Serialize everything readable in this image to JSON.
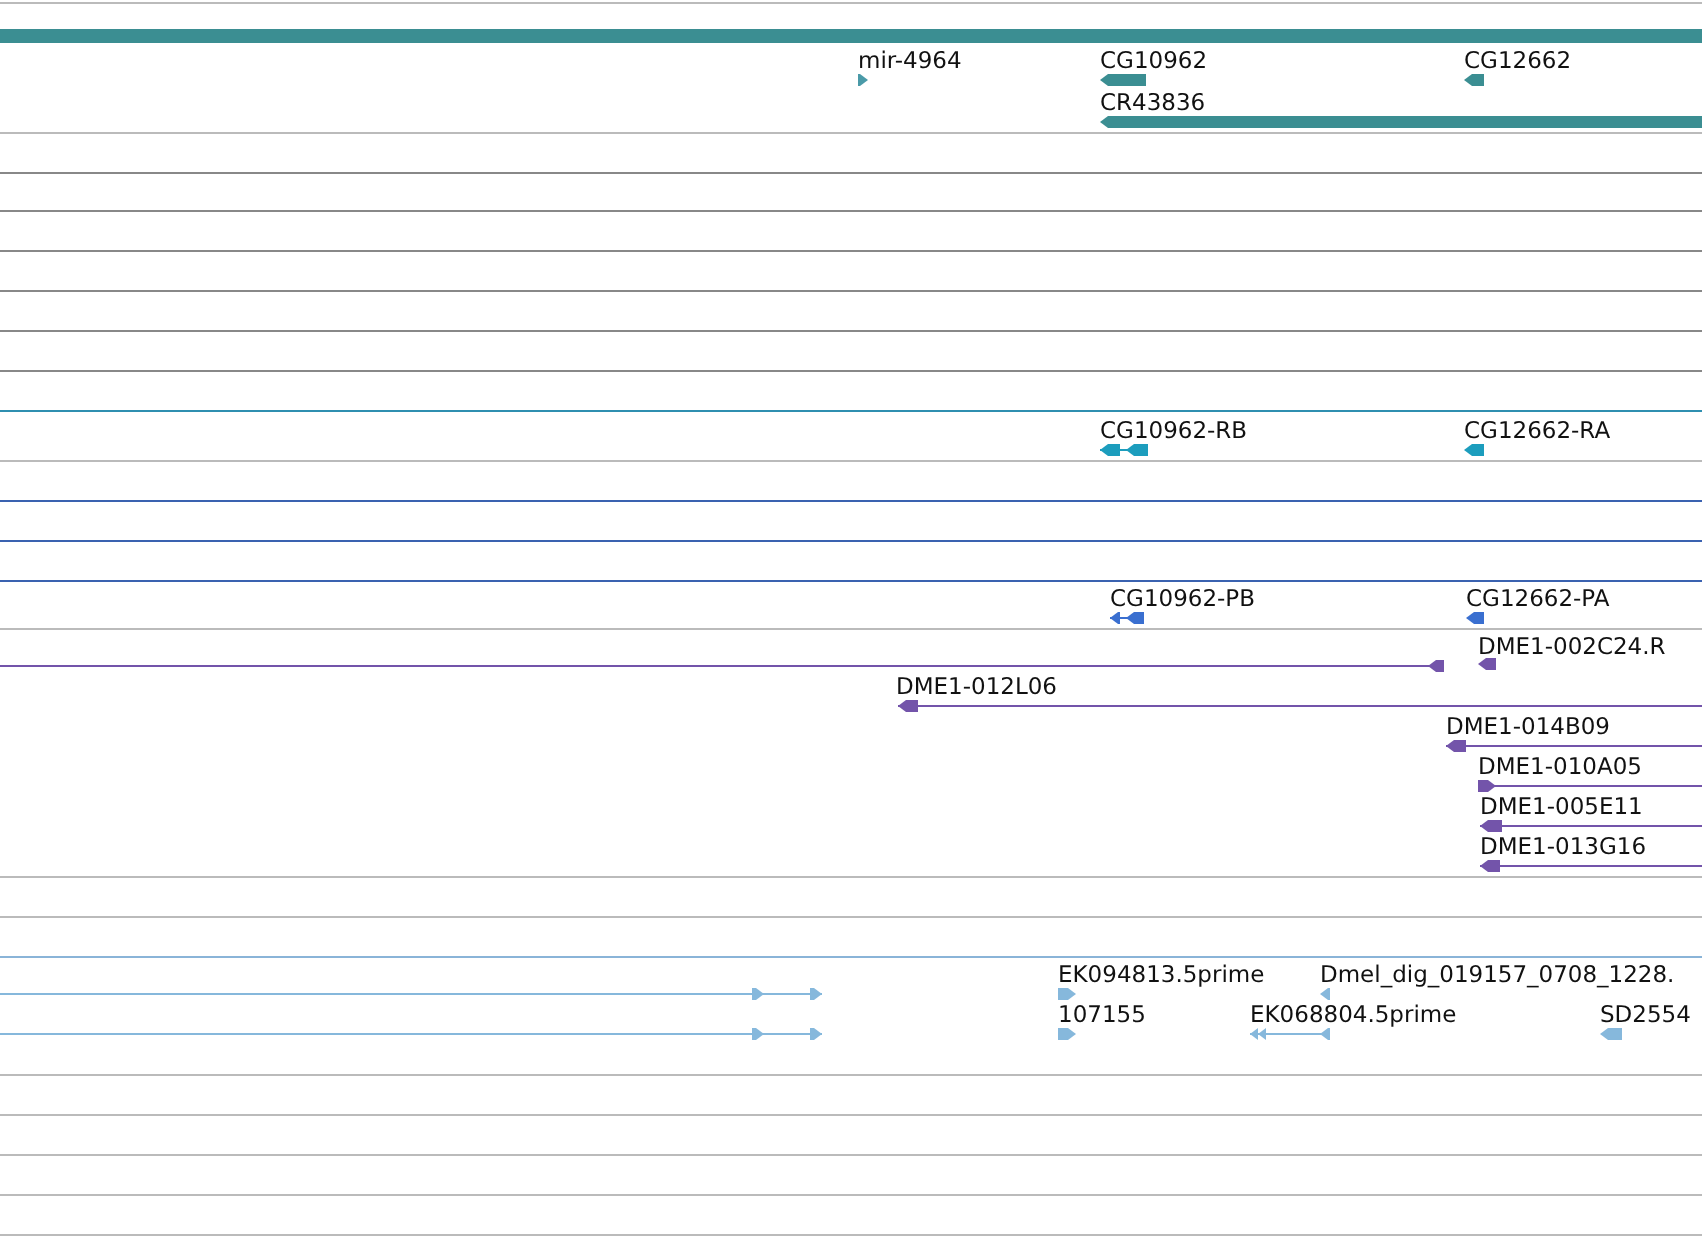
{
  "features": [
    {
      "color": "#3b8e92"
    },
    {
      "label": "mir-4964",
      "reverse": false,
      "color": "#4a9aa8"
    },
    {
      "label": "CG10962",
      "reverse": true,
      "color": "#3b8e92"
    },
    {
      "label": "CG12662",
      "reverse": true,
      "color": "#3b8e92"
    },
    {
      "label": "CR43836",
      "reverse": true,
      "color": "#3b8e92"
    },
    {
      "label": "CG10962-RB",
      "reverse": true,
      "color": "#1c9dbd"
    },
    {
      "label": "CG12662-RA",
      "reverse": true,
      "color": "#1c9dbd"
    },
    {
      "label": "CG10962-PB",
      "reverse": true,
      "color": "#3a6fd0"
    },
    {
      "label": "CG12662-PA",
      "reverse": true,
      "color": "#3a6fd0"
    },
    {
      "reverse": true,
      "color": "#7354aa"
    },
    {
      "label": "DME1-002C24.R",
      "reverse": true,
      "color": "#7354aa"
    },
    {
      "label": "DME1-012L06",
      "reverse": true,
      "color": "#7354aa"
    },
    {
      "label": "DME1-014B09",
      "reverse": true,
      "color": "#7354aa"
    },
    {
      "label": "DME1-010A05",
      "reverse": false,
      "color": "#7354aa"
    },
    {
      "label": "DME1-005E11",
      "reverse": true,
      "color": "#7354aa"
    },
    {
      "label": "DME1-013G16",
      "reverse": true,
      "color": "#7354aa"
    },
    {
      "reverse": false,
      "color": "#86b8dc"
    },
    {
      "label": "EK094813.5prime",
      "reverse": false,
      "color": "#86b8dc"
    },
    {
      "label": "Dmel_dig_019157_0708_1228.",
      "reverse": true,
      "color": "#86b8dc"
    },
    {
      "reverse": false,
      "color": "#86b8dc"
    },
    {
      "label": "107155",
      "reverse": false,
      "color": "#86b8dc"
    },
    {
      "label": "EK068804.5prime",
      "reverse": true,
      "color": "#86b8dc"
    },
    {
      "label": "SD2554",
      "reverse": true,
      "color": "#86b8dc"
    }
  ]
}
